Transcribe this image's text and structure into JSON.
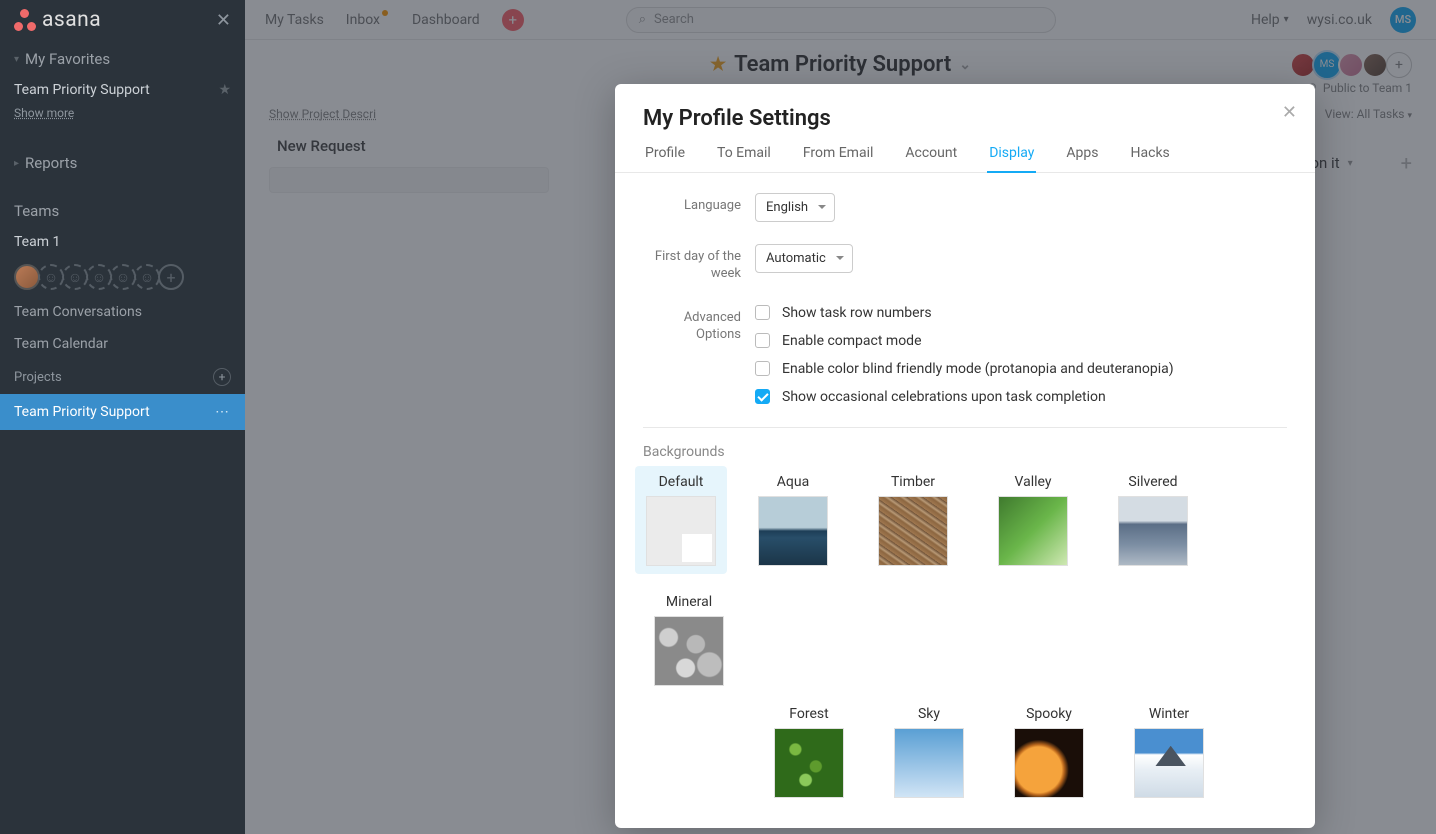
{
  "brand": "asana",
  "sidebar": {
    "favorites_header": "My Favorites",
    "favorite_item": "Team Priority Support",
    "show_more": "Show more",
    "reports_header": "Reports",
    "teams_header": "Teams",
    "team_name": "Team 1",
    "team_conversations": "Team Conversations",
    "team_calendar": "Team Calendar",
    "projects_header": "Projects",
    "project_item": "Team Priority Support"
  },
  "topbar": {
    "my_tasks": "My Tasks",
    "inbox": "Inbox",
    "dashboard": "Dashboard",
    "search_placeholder": "Search",
    "help": "Help",
    "workspace": "wysi.co.uk",
    "user_initials": "MS"
  },
  "project": {
    "title": "Team Priority Support",
    "visibility": "Public to Team 1",
    "show_desc": "Show Project Descri",
    "view": "View: All Tasks",
    "col_new_request": "New Request",
    "col_working": "Working on it",
    "member_badge": "MS"
  },
  "modal": {
    "title": "My Profile Settings",
    "tabs": {
      "profile": "Profile",
      "to_email": "To Email",
      "from_email": "From Email",
      "account": "Account",
      "display": "Display",
      "apps": "Apps",
      "hacks": "Hacks"
    },
    "language_label": "Language",
    "language_value": "English",
    "first_day_label": "First day of the week",
    "first_day_value": "Automatic",
    "advanced_label": "Advanced Options",
    "checks": {
      "row_numbers": "Show task row numbers",
      "compact": "Enable compact mode",
      "colorblind": "Enable color blind friendly mode (protanopia and deuteranopia)",
      "celebrations": "Show occasional celebrations upon task completion"
    },
    "backgrounds_header": "Backgrounds",
    "backgrounds": {
      "default": "Default",
      "aqua": "Aqua",
      "timber": "Timber",
      "valley": "Valley",
      "silvered": "Silvered",
      "mineral": "Mineral",
      "forest": "Forest",
      "sky": "Sky",
      "spooky": "Spooky",
      "winter": "Winter"
    }
  }
}
